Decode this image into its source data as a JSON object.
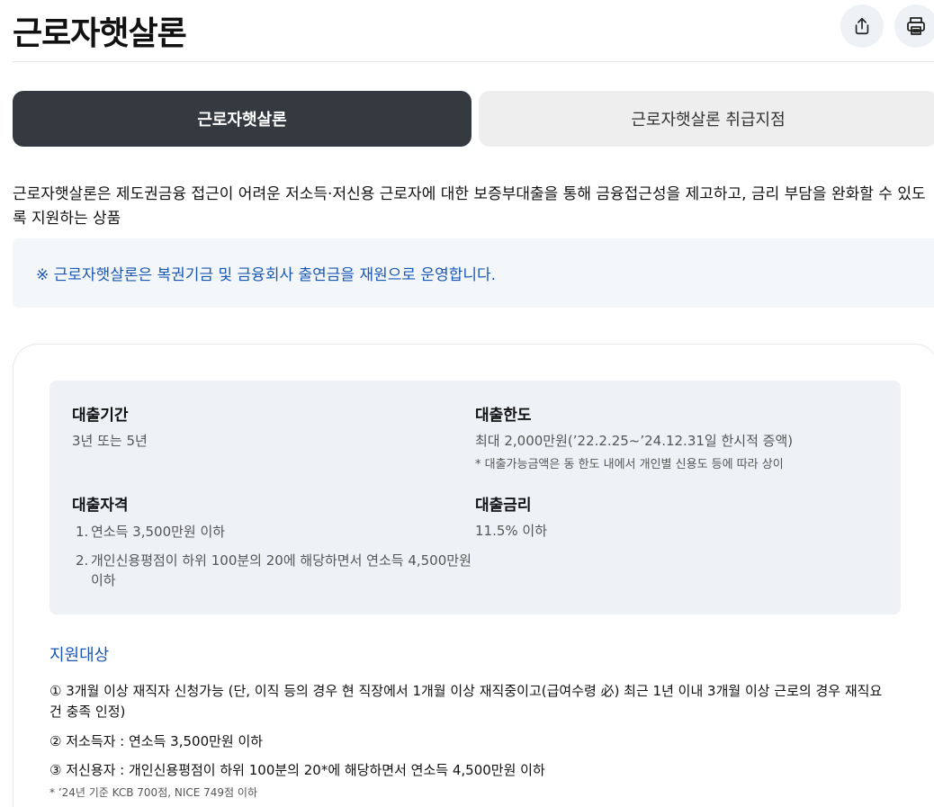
{
  "header": {
    "title": "근로자햇살론",
    "share_icon": "share-icon",
    "print_icon": "print-icon"
  },
  "tabs": [
    {
      "label": "근로자햇살론",
      "active": true
    },
    {
      "label": "근로자햇살론 취급지점",
      "active": false
    }
  ],
  "intro": "근로자햇살론은 제도권금융 접근이 어려운 저소득·저신용 근로자에 대한 보증부대출을 통해 금융접근성을 제고하고, 금리 부담을 완화할 수 있도록 지원하는 상품",
  "notice": "※ 근로자햇살론은 복권기금 및 금융회사 출연금을 재원으로 운영합니다.",
  "info": {
    "period": {
      "label": "대출기간",
      "value": "3년 또는 5년"
    },
    "limit": {
      "label": "대출한도",
      "value": "최대 2,000만원(’22.2.25~’24.12.31일 한시적 증액)",
      "note": "* 대출가능금액은 동 한도 내에서 개인별 신용도 등에 따라 상이"
    },
    "eligibility": {
      "label": "대출자격",
      "items": [
        {
          "num": "1.",
          "text": "연소득 3,500만원 이하"
        },
        {
          "num": "2.",
          "text": "개인신용평점이 하위 100분의 20에 해당하면서 연소득 4,500만원 이하"
        }
      ]
    },
    "rate": {
      "label": "대출금리",
      "value": "11.5% 이하"
    }
  },
  "support": {
    "title": "지원대상",
    "items": [
      "① 3개월 이상 재직자 신청가능 (단, 이직 등의 경우 현 직장에서 1개월 이상 재직중이고(급여수령 必) 최근 1년 이내 3개월 이상 근로의 경우 재직요건 충족 인정)",
      "② 저소득자 : 연소득 3,500만원 이하",
      "③ 저신용자 : 개인신용평점이 하위 100분의 20*에 해당하면서 연소득 4,500만원 이하"
    ],
    "note": "* ’24년 기준 KCB 700점, NICE 749점 이하"
  },
  "colors": {
    "accent_blue": "#1a57b5",
    "tab_active_bg": "#343a40",
    "info_bg": "#eef2f7"
  }
}
